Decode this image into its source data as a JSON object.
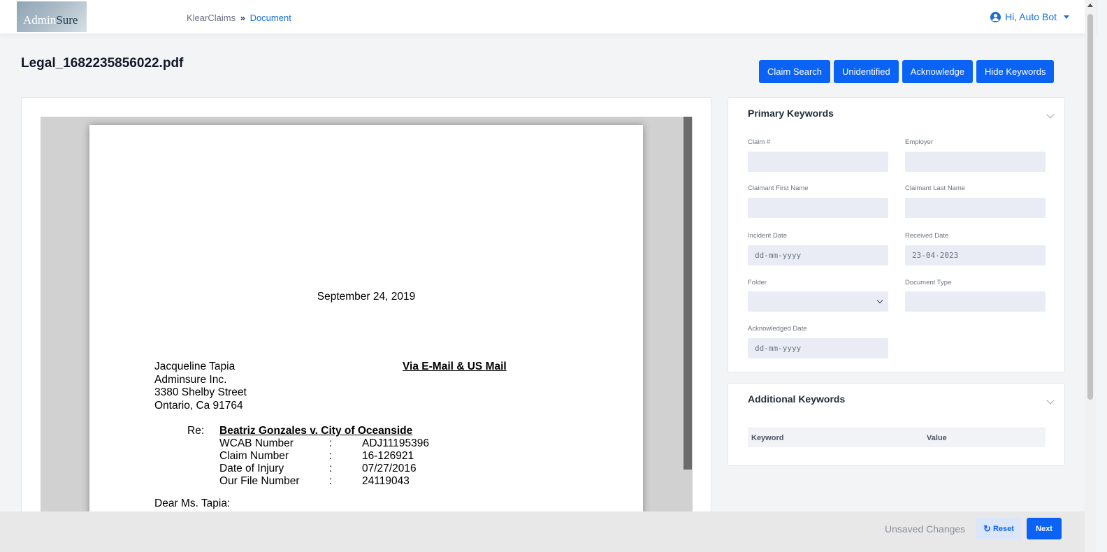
{
  "header": {
    "logo": {
      "part1": "Admin",
      "part2": "Sure"
    },
    "breadcrumb": {
      "root": "KlearClaims",
      "separator": "»",
      "current": "Document"
    },
    "user": {
      "greeting": "Hi, Auto Bot",
      "icon": "user-circle-icon"
    }
  },
  "document": {
    "title": "Legal_1682235856022.pdf",
    "actions": {
      "claim_search": "Claim Search",
      "unidentified": "Unidentified",
      "acknowledge": "Acknowledge",
      "hide_keywords": "Hide Keywords"
    }
  },
  "pdf": {
    "date": "September 24, 2019",
    "address": [
      "Jacqueline Tapia",
      "Adminsure Inc.",
      "3380 Shelby Street",
      "Ontario, Ca 91764"
    ],
    "via": "Via E-Mail & US Mail",
    "re_label": "Re:",
    "re_title": "Beatriz Gonzales v. City of Oceanside",
    "re_rows": [
      {
        "key": "WCAB Number",
        "colon": ":",
        "value": "ADJ11195396"
      },
      {
        "key": "Claim Number",
        "colon": ":",
        "value": "16-126921"
      },
      {
        "key": "Date of Injury",
        "colon": ":",
        "value": "07/27/2016"
      },
      {
        "key": "Our File Number",
        "colon": ":",
        "value": "24119043"
      }
    ],
    "salutation": "Dear Ms. Tapia:"
  },
  "primary_keywords": {
    "title": "Primary Keywords",
    "fields": {
      "claim_no": {
        "label": "Claim #",
        "value": ""
      },
      "employer": {
        "label": "Employer",
        "value": ""
      },
      "first_name": {
        "label": "Claimant First Name",
        "value": ""
      },
      "last_name": {
        "label": "Claimant Last Name",
        "value": ""
      },
      "incident_date": {
        "label": "Incident Date",
        "value": "dd-mm-yyyy"
      },
      "received_date": {
        "label": "Received Date",
        "value": "23-04-2023"
      },
      "folder": {
        "label": "Folder",
        "value": ""
      },
      "document_type": {
        "label": "Document Type",
        "value": ""
      },
      "acknowledged_date": {
        "label": "Acknowledged Date",
        "value": "dd-mm-yyyy"
      }
    }
  },
  "additional_keywords": {
    "title": "Additional Keywords",
    "columns": {
      "keyword": "Keyword",
      "value": "Value"
    }
  },
  "footer": {
    "status": "Unsaved Changes",
    "reset": "Reset",
    "next": "Next"
  }
}
